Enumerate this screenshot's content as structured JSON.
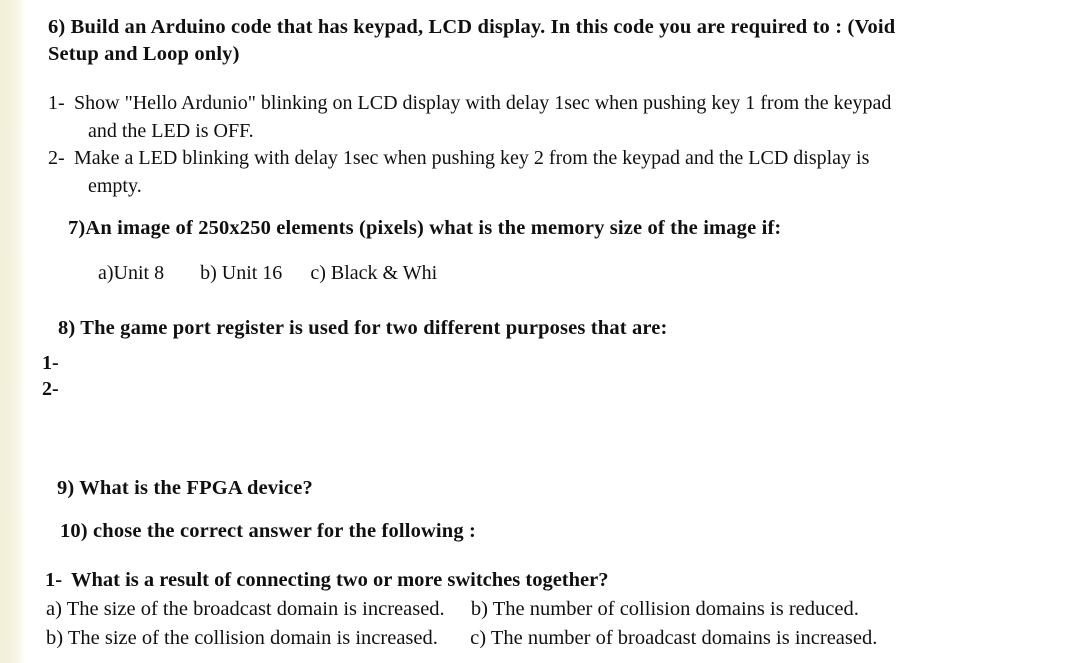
{
  "document": {
    "type": "exam-question-sheet",
    "background_color": "#ffffff",
    "edge_strip_color": "#f2efd9",
    "text_color": "#101010"
  },
  "q6": {
    "line1": "6) Build an Arduino code that has keypad, LCD display. In this code you are required to : (Void",
    "line2": "Setup and Loop only)",
    "items": [
      {
        "number": "1-",
        "line1": "Show \"Hello Ardunio\" blinking on LCD display with delay 1sec when pushing key 1 from the keypad",
        "line2": "and the LED is OFF."
      },
      {
        "number": "2-",
        "line1": "Make a LED blinking with delay 1sec when pushing key 2 from the keypad and the LCD display is",
        "line2": "empty."
      }
    ]
  },
  "q7": {
    "prompt": "7)An image of 250x250 elements  (pixels) what is the memory size of the image if:",
    "options": [
      "a)Unit 8",
      "b) Unit 16",
      "c) Black & Whi"
    ]
  },
  "q8": {
    "prompt": "8) The game port register is used for two different purposes that are:",
    "blanks": [
      {
        "number": "1-",
        "answer": ""
      },
      {
        "number": "2-",
        "answer": ""
      }
    ]
  },
  "q9": {
    "prompt": "9) What is the FPGA device?"
  },
  "q10": {
    "prompt": "10) chose the correct answer for the following : ",
    "sub_questions": [
      {
        "number": "1-",
        "prompt": "What is a result of connecting two or more switches together?",
        "answers": [
          {
            "label": "a)",
            "text": "The size of the broadcast domain is increased."
          },
          {
            "label": "b)",
            "text": "The number of collision domains is reduced."
          },
          {
            "label": "b)",
            "text": "The size of the collision domain is increased."
          },
          {
            "label": "c)",
            "text": "The number of broadcast domains is increased."
          }
        ]
      }
    ]
  }
}
